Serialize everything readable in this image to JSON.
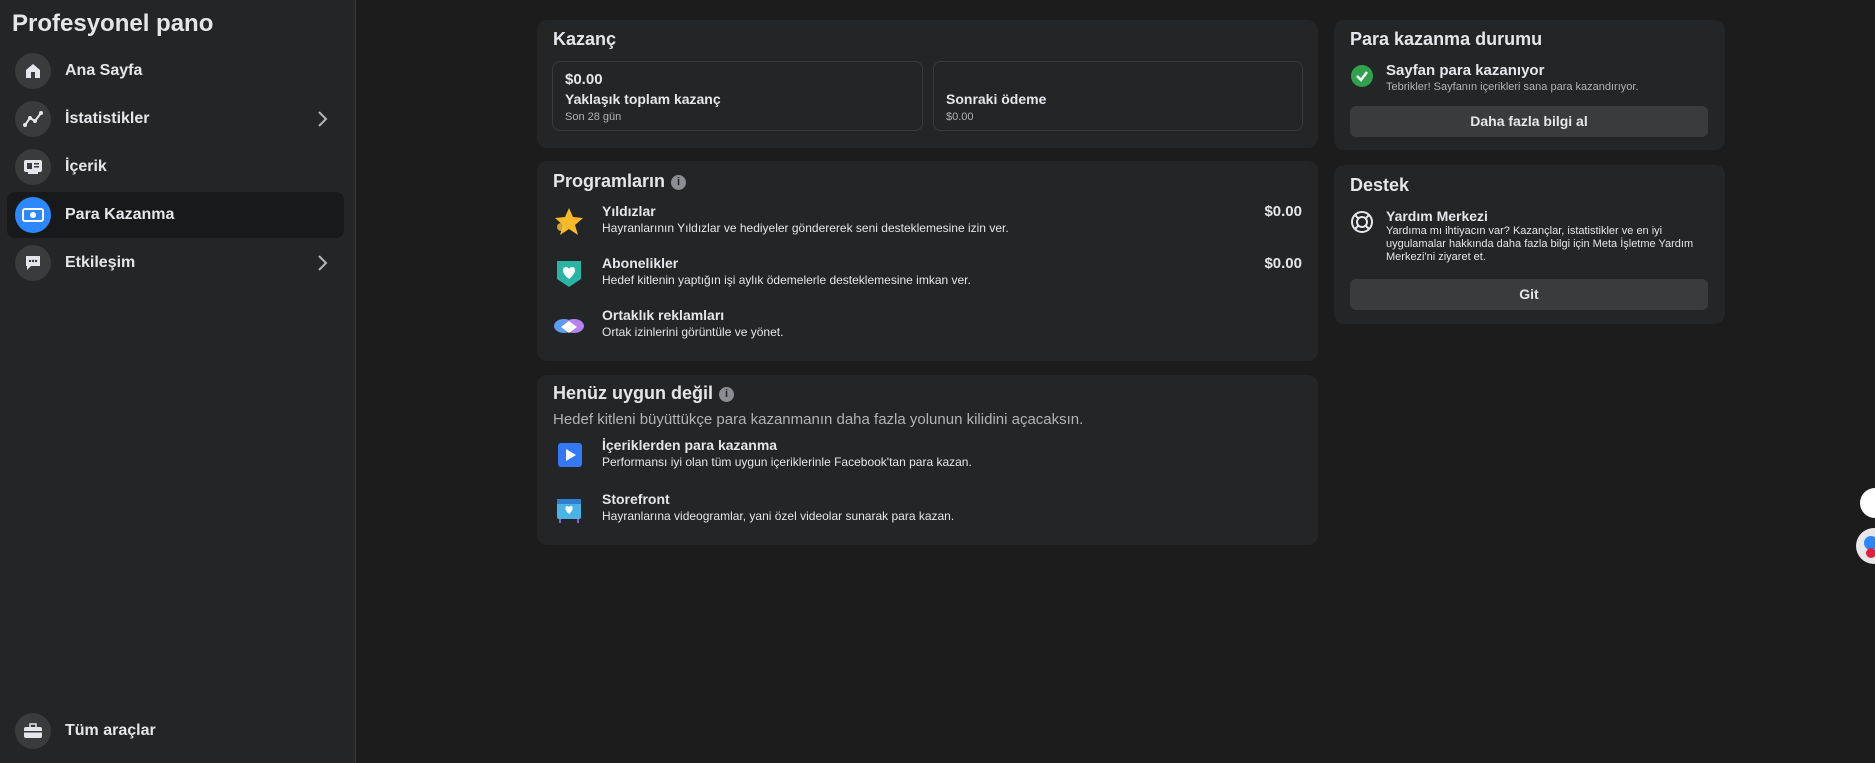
{
  "sidebar": {
    "title": "Profesyonel pano",
    "items": [
      {
        "label": "Ana Sayfa",
        "icon": "home-icon"
      },
      {
        "label": "İstatistikler",
        "icon": "stats-icon"
      },
      {
        "label": "İçerik",
        "icon": "content-icon"
      },
      {
        "label": "Para Kazanma",
        "icon": "monetization-icon",
        "active": true
      },
      {
        "label": "Etkileşim",
        "icon": "chat-icon"
      }
    ],
    "bottom_item": {
      "label": "Tüm araçlar",
      "icon": "toolbox-icon"
    }
  },
  "earnings": {
    "title": "Kazanç",
    "total": {
      "value": "$0.00",
      "label": "Yaklaşık toplam kazanç",
      "period": "Son 28 gün"
    },
    "next_payment": {
      "label": "Sonraki ödeme",
      "value": "$0.00"
    }
  },
  "programs": {
    "title": "Programların",
    "items": [
      {
        "title": "Yıldızlar",
        "desc": "Hayranlarının Yıldızlar ve hediyeler göndererek seni desteklemesine izin ver.",
        "amount": "$0.00",
        "icon": "star-icon"
      },
      {
        "title": "Abonelikler",
        "desc": "Hedef kitlenin yaptığın işi aylık ödemelerle desteklemesine imkan ver.",
        "amount": "$0.00",
        "icon": "heart-badge-icon"
      },
      {
        "title": "Ortaklık reklamları",
        "desc": "Ortak izinlerini görüntüle ve yönet.",
        "icon": "handshake-icon"
      }
    ]
  },
  "not_eligible": {
    "title": "Henüz uygun değil",
    "subtitle": "Hedef kitleni büyüttükçe para kazanmanın daha fazla yolunun kilidini açacaksın.",
    "items": [
      {
        "title": "İçeriklerden para kazanma",
        "desc": "Performansı iyi olan tüm uygun içeriklerinle Facebook'tan para kazan.",
        "icon": "play-icon"
      },
      {
        "title": "Storefront",
        "desc": "Hayranlarına videogramlar, yani özel videolar sunarak para kazan.",
        "icon": "storefront-icon"
      }
    ]
  },
  "status": {
    "title": "Para kazanma durumu",
    "heading": "Sayfan para kazanıyor",
    "desc": "Tebrikler! Sayfanın içerikleri sana para kazandırıyor.",
    "button": "Daha fazla bilgi al"
  },
  "support": {
    "title": "Destek",
    "heading": "Yardım Merkezi",
    "desc": "Yardıma mı ihtiyacın var? Kazançlar, istatistikler ve en iyi uygulamalar hakkında daha fazla bilgi için Meta İşletme Yardım Merkezi'ni ziyaret et.",
    "button": "Git"
  },
  "colors": {
    "accent": "#2d88ff",
    "success": "#31a24c",
    "card": "#242526",
    "background": "#1c1c1d"
  }
}
